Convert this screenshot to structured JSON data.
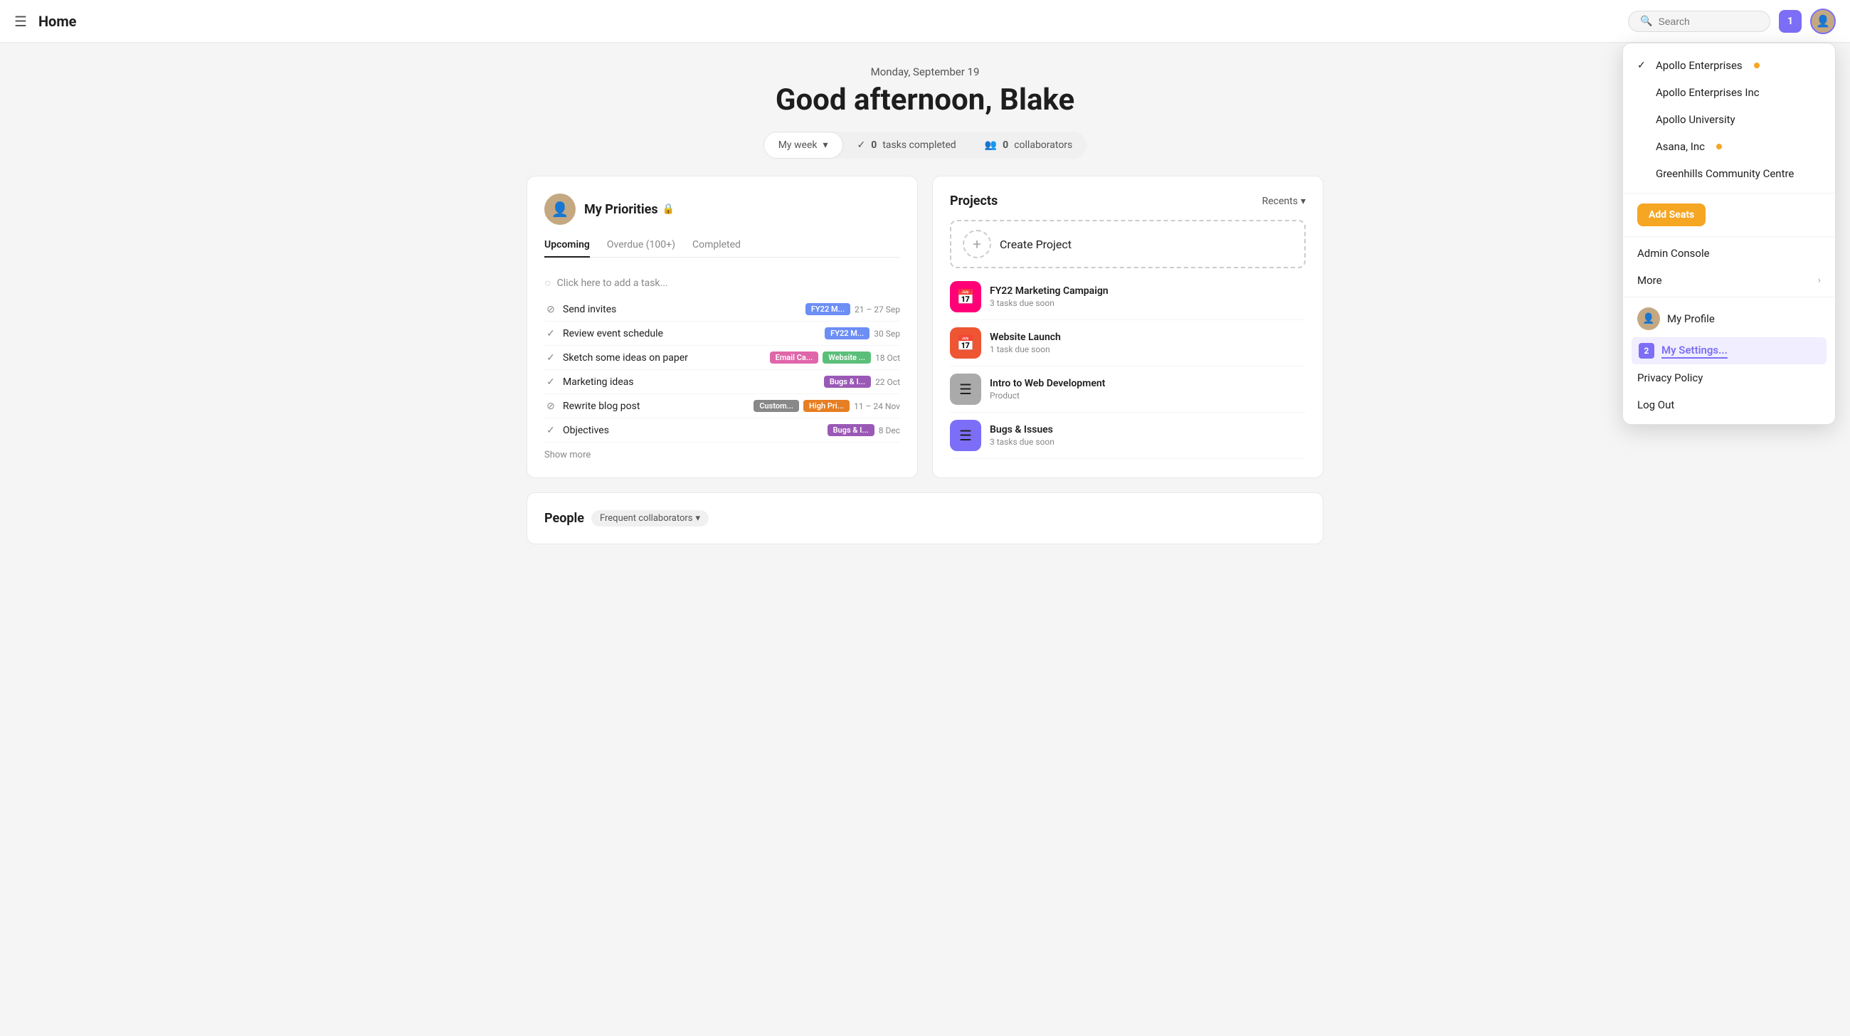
{
  "nav": {
    "hamburger": "☰",
    "title": "Home",
    "search_placeholder": "Search",
    "notif_count": "1"
  },
  "hero": {
    "date": "Monday, September 19",
    "greeting": "Good afternoon, Blake",
    "week_label": "My week",
    "tasks_count": "0",
    "tasks_label": "tasks completed",
    "collab_count": "0",
    "collab_label": "collaborators"
  },
  "priorities": {
    "title": "My Priorities",
    "lock": "🔒",
    "tabs": [
      "Upcoming",
      "Overdue (100+)",
      "Completed"
    ],
    "active_tab": "Upcoming",
    "add_task_placeholder": "Click here to add a task...",
    "tasks": [
      {
        "icon": "○",
        "name": "Send invites",
        "tags": [
          "FY22 M..."
        ],
        "tag_colors": [
          "blue"
        ],
        "date": "21 – 27 Sep"
      },
      {
        "icon": "✓",
        "name": "Review event schedule",
        "tags": [
          "FY22 M..."
        ],
        "tag_colors": [
          "blue"
        ],
        "date": "30 Sep"
      },
      {
        "icon": "✓",
        "name": "Sketch some ideas on paper",
        "tags": [
          "Email Ca...",
          "Website ..."
        ],
        "tag_colors": [
          "pink",
          "green"
        ],
        "date": "18 Oct"
      },
      {
        "icon": "✓",
        "name": "Marketing ideas",
        "tags": [
          "Bugs & I..."
        ],
        "tag_colors": [
          "purple"
        ],
        "date": "22 Oct"
      },
      {
        "icon": "○",
        "name": "Rewrite blog post",
        "tags": [
          "Custom...",
          "High Pri..."
        ],
        "tag_colors": [
          "gray",
          "orange"
        ],
        "date": "11 – 24 Nov"
      },
      {
        "icon": "✓",
        "name": "Objectives",
        "tags": [
          "Bugs & I..."
        ],
        "tag_colors": [
          "purple"
        ],
        "date": "8 Dec"
      }
    ],
    "show_more": "Show more"
  },
  "projects": {
    "title": "Projects",
    "recents": "Recents",
    "create_label": "Create Project",
    "items": [
      {
        "name": "FY22 Marketing Campaign",
        "sub": "3 tasks due soon",
        "icon": "📅",
        "color": "pink"
      },
      {
        "name": "Website Launch",
        "sub": "1 task due soon",
        "icon": "📅",
        "color": "red"
      },
      {
        "name": "Intro to Web Development",
        "sub": "Product",
        "icon": "☰",
        "color": "gray"
      },
      {
        "name": "Bugs & Issues",
        "sub": "3 tasks due soon",
        "icon": "☰",
        "color": "purple"
      }
    ]
  },
  "people": {
    "title": "People",
    "collab_label": "Frequent collaborators"
  },
  "dropdown": {
    "orgs": [
      {
        "name": "Apollo Enterprises",
        "checked": true,
        "dot": true
      },
      {
        "name": "Apollo Enterprises Inc",
        "checked": false,
        "dot": false
      },
      {
        "name": "Apollo University",
        "checked": false,
        "dot": false
      },
      {
        "name": "Asana, Inc",
        "checked": false,
        "dot": true
      },
      {
        "name": "Greenhills Community Centre",
        "checked": false,
        "dot": false
      }
    ],
    "add_seats": "Add Seats",
    "admin_console": "Admin Console",
    "more": "More",
    "my_profile": "My Profile",
    "my_settings": "My Settings...",
    "privacy_policy": "Privacy Policy",
    "log_out": "Log Out",
    "step_number": "2"
  },
  "tag_colors": {
    "blue": "#6c8ef5",
    "green": "#5bbf7a",
    "pink": "#e066aa",
    "gray": "#888888",
    "purple": "#9b59b6",
    "orange": "#e67e22"
  }
}
